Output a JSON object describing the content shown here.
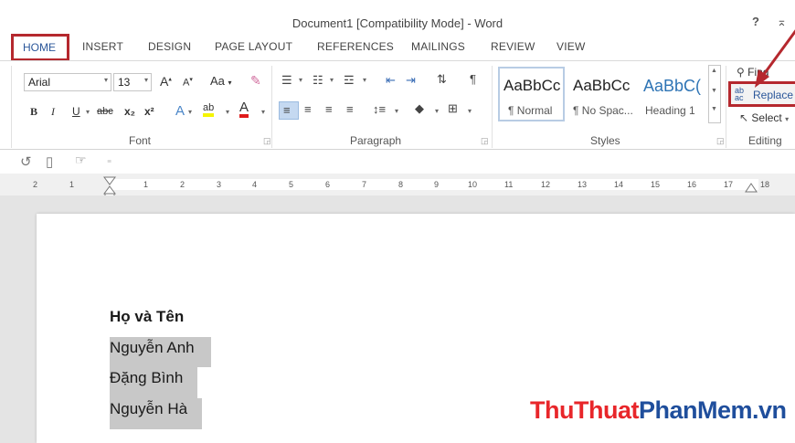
{
  "window": {
    "title": "Document1 [Compatibility Mode] - Word",
    "help": "?",
    "restore": "⌅"
  },
  "tabs": [
    "HOME",
    "INSERT",
    "DESIGN",
    "PAGE LAYOUT",
    "REFERENCES",
    "MAILINGS",
    "REVIEW",
    "VIEW"
  ],
  "font": {
    "name": "Arial",
    "size": "13",
    "group_label": "Font",
    "grow": "A",
    "shrink": "A",
    "change_case": "Aa",
    "bold": "B",
    "italic": "I",
    "underline": "U",
    "strike": "abc",
    "subscript": "x₂",
    "superscript": "x²",
    "effects": "A",
    "highlight": "ab",
    "color": "A"
  },
  "paragraph": {
    "group_label": "Paragraph",
    "show_marks": "¶"
  },
  "styles": {
    "group_label": "Styles",
    "items": [
      {
        "sample": "AaBbCc",
        "name": "¶ Normal"
      },
      {
        "sample": "AaBbCc",
        "name": "¶ No Spac..."
      },
      {
        "sample": "AaBbC(",
        "name": "Heading 1"
      }
    ],
    "heading_color": "#2e74b5"
  },
  "editing": {
    "group_label": "Editing",
    "find": "Find",
    "replace": "Replace",
    "select": "Select"
  },
  "ruler": [
    "2",
    "1",
    "1",
    "2",
    "3",
    "4",
    "5",
    "6",
    "7",
    "8",
    "9",
    "10",
    "11",
    "12",
    "13",
    "14",
    "15",
    "16",
    "17",
    "18"
  ],
  "document": {
    "heading": "Họ và Tên",
    "lines": [
      "Nguyễn Anh",
      "Đặng Bình",
      "Nguyễn Hà"
    ]
  },
  "watermark": {
    "part1": "ThuThuat",
    "part2": "PhanMem",
    "part3": ".vn",
    "color_red": "#e8262a",
    "color_blue": "#1f4e9c"
  },
  "colors": {
    "accent": "#2b579a",
    "highlight_box": "#b5282e"
  }
}
